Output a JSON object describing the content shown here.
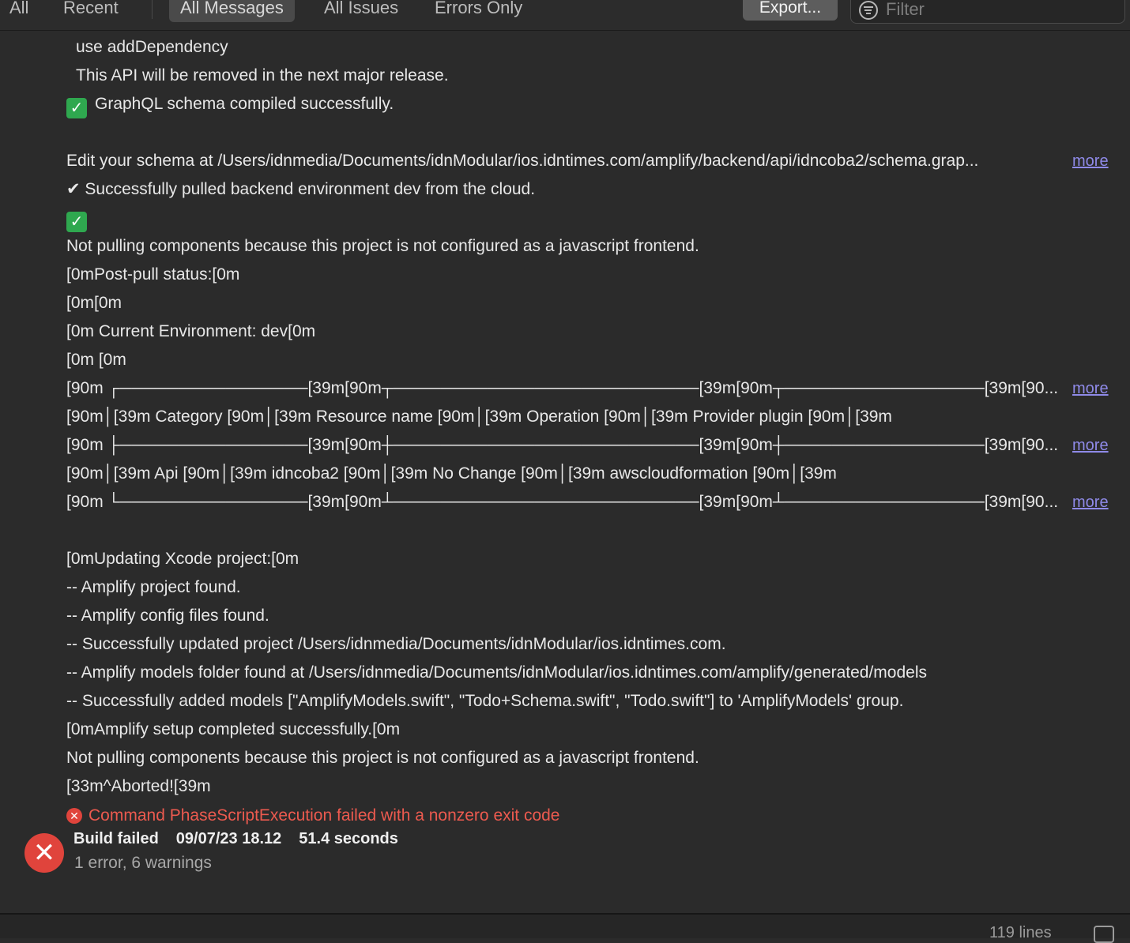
{
  "toolbar": {
    "scope_tabs": [
      "All",
      "Recent"
    ],
    "message_tabs": [
      "All Messages",
      "All Issues",
      "Errors Only"
    ],
    "export_label": "Export...",
    "filter_placeholder": "Filter"
  },
  "log": {
    "lines": [
      "use addDependency",
      "This API will be removed in the next major release.",
      "GraphQL schema compiled successfully.",
      "",
      "Edit your schema at /Users/idnmedia/Documents/idnModular/ios.idntimes.com/amplify/backend/api/idncoba2/schema.grap...",
      "✔ Successfully pulled backend environment dev from the cloud.",
      "",
      "Not pulling components because this project is not configured as a javascript frontend.",
      "[0mPost-pull status:[0m",
      "[0m[0m",
      "[0m    Current Environment: dev[0m",
      "[0m    [0m",
      "[90m ┌────────────────[39m[90m┬──────────────────────────[39m[90m┬─────────────────[39m[90...",
      "[90m│[39m Category [90m│[39m Resource name [90m│[39m Operation [90m│[39m Provider plugin   [90m│[39m",
      "[90m ├────────────────[39m[90m┼──────────────────────────[39m[90m┼─────────────────[39m[90...",
      "[90m│[39m Api      [90m│[39m idncoba2      [90m│[39m No Change [90m│[39m awscloudformation [90m│[39m",
      "[90m └────────────────[39m[90m┴──────────────────────────[39m[90m┴─────────────────[39m[90...",
      "",
      "[0mUpdating Xcode project:[0m",
      "-- Amplify project found.",
      "-- Amplify config files found.",
      "-- Successfully updated project /Users/idnmedia/Documents/idnModular/ios.idntimes.com.",
      "-- Amplify models folder found at /Users/idnmedia/Documents/idnModular/ios.idntimes.com/amplify/generated/models",
      "-- Successfully added models [\"AmplifyModels.swift\", \"Todo+Schema.swift\", \"Todo.swift\"] to 'AmplifyModels' group.",
      "[0mAmplify setup completed successfully.[0m",
      "Not pulling components because this project is not configured as a javascript frontend.",
      "[33m^Aborted![39m"
    ],
    "more_label": "more",
    "error_message": "Command PhaseScriptExecution failed with a nonzero exit code"
  },
  "build": {
    "status": "Build failed",
    "date": "09/07/23 18.12",
    "duration": "51.4 seconds",
    "summary": "1 error, 6 warnings"
  },
  "status_bar": {
    "line_count": "119 lines"
  }
}
